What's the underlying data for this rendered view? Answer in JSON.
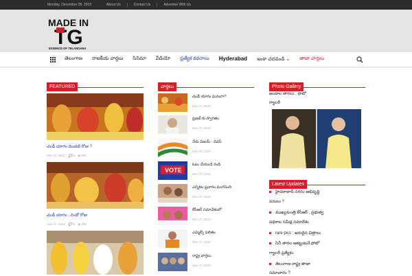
{
  "topbar": {
    "date": "Monday, December 28, 2015",
    "links": [
      "About Us",
      "Contact Us",
      "Advertise With Us"
    ]
  },
  "logo": {
    "line1": "MADE IN",
    "line2": "TG",
    "tag": "ESSENCE OF TELANGANA"
  },
  "nav": {
    "items": [
      "తెలంగాణ",
      "రాజకీయ వార్తలు",
      "సినిమా",
      "వీడియో",
      "ప్రత్యేక కథనాలు",
      "Hyderabad",
      "ఇంకా చదవండి",
      "తాజా వార్తలు"
    ]
  },
  "featured": {
    "header": "FEATURED",
    "posts": [
      {
        "title": "చండీ యాగం మొదటి రోజు ?",
        "date": "Dec 27, 2015",
        "comments": "0",
        "views": "605"
      },
      {
        "title": "చండీ యాగం ..రెండో రోజు",
        "date": "Dec 27, 2015",
        "comments": "0",
        "views": "390"
      },
      {
        "title": "",
        "date": "",
        "comments": "",
        "views": ""
      }
    ]
  },
  "latest": {
    "header": "వార్తలు",
    "posts": [
      {
        "title": "చండీ యాగం ఘనంగా?",
        "date": "Dec 27, 2015"
      },
      {
        "title": "ప్రణబ్ కు స్వాగతం",
        "date": "Dec 27, 2015"
      },
      {
        "title": "నేడు విజయ్ : దివస్",
        "date": "Dec 27, 2015"
      },
      {
        "title": "ఓటు వేయండి రండి",
        "date": "Dec 27, 2015"
      },
      {
        "title": "ఎన్నికల ప్రచారం ముగిసింది",
        "date": "Dec 27, 2015"
      },
      {
        "title": "కేసీఆర్ సమావేశంలో",
        "date": "Dec 27, 2015"
      },
      {
        "title": "ఎమ్మెల్సీ ఫలితం",
        "date": "Dec 27, 2015"
      },
      {
        "title": "రాష్ట్ర వార్తలు",
        "date": "Dec 27, 2015"
      }
    ]
  },
  "gallery": {
    "header": "Photo Gallery",
    "title_line1": "అందాల తారలు , ఫొటో",
    "title_line2": "గ్యాలరీ"
  },
  "updates": {
    "header": "Latest Updates",
    "items": [
      {
        "l1": "హైదరాబాద్ నగరం అభివృద్ధి",
        "l2": "పనులు ?"
      },
      {
        "l1": "ముఖ్యమంత్రి కేసీఆర్ , ప్రభుత్వ",
        "l2": "పథకాల సమీక్ష సమావేశం"
      },
      {
        "l1": "rare pics : అరుదైన చిత్రాలు",
        "l2": ""
      },
      {
        "l1": "సినీ తారల ఆకట్టుకునే ఫోటో",
        "l2": "గ్యాలరీ ప్రత్యేకం"
      },
      {
        "l1": "తెలంగాణ రాష్ట్ర తాజా",
        "l2": "సమాచారం ?"
      }
    ]
  }
}
